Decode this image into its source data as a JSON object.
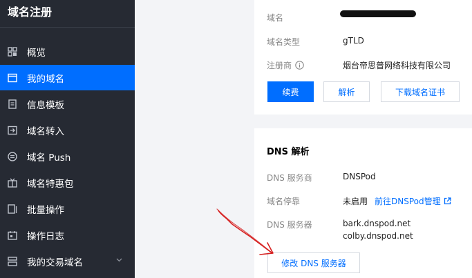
{
  "sidebar": {
    "title": "域名注册",
    "items": [
      {
        "label": "概览",
        "icon": "dashboard-icon"
      },
      {
        "label": "我的域名",
        "icon": "domain-icon",
        "active": true
      },
      {
        "label": "信息模板",
        "icon": "template-icon"
      },
      {
        "label": "域名转入",
        "icon": "transfer-in-icon"
      },
      {
        "label": "域名 Push",
        "icon": "push-icon"
      },
      {
        "label": "域名特惠包",
        "icon": "gift-icon"
      },
      {
        "label": "批量操作",
        "icon": "batch-icon"
      },
      {
        "label": "操作日志",
        "icon": "log-icon"
      },
      {
        "label": "我的交易域名",
        "icon": "trade-icon"
      }
    ]
  },
  "domain_info": {
    "domain_label": "域名",
    "type_label": "域名类型",
    "type_value": "gTLD",
    "registrar_label": "注册商",
    "registrar_value": "烟台帝思普网络科技有限公司",
    "buttons": {
      "renew": "续费",
      "resolve": "解析",
      "download_cert": "下载域名证书"
    }
  },
  "dns": {
    "title": "DNS 解析",
    "provider_label": "DNS 服务商",
    "provider_value": "DNSPod",
    "parking_label": "域名停靠",
    "parking_value": "未启用",
    "parking_link": "前往DNSPod管理",
    "servers_label": "DNS 服务器",
    "servers": [
      "bark.dnspod.net",
      "colby.dnspod.net"
    ],
    "modify_button": "修改 DNS 服务器"
  },
  "colors": {
    "accent": "#006eff",
    "sidebar_bg": "#262a33",
    "annotation": "#d62020"
  }
}
